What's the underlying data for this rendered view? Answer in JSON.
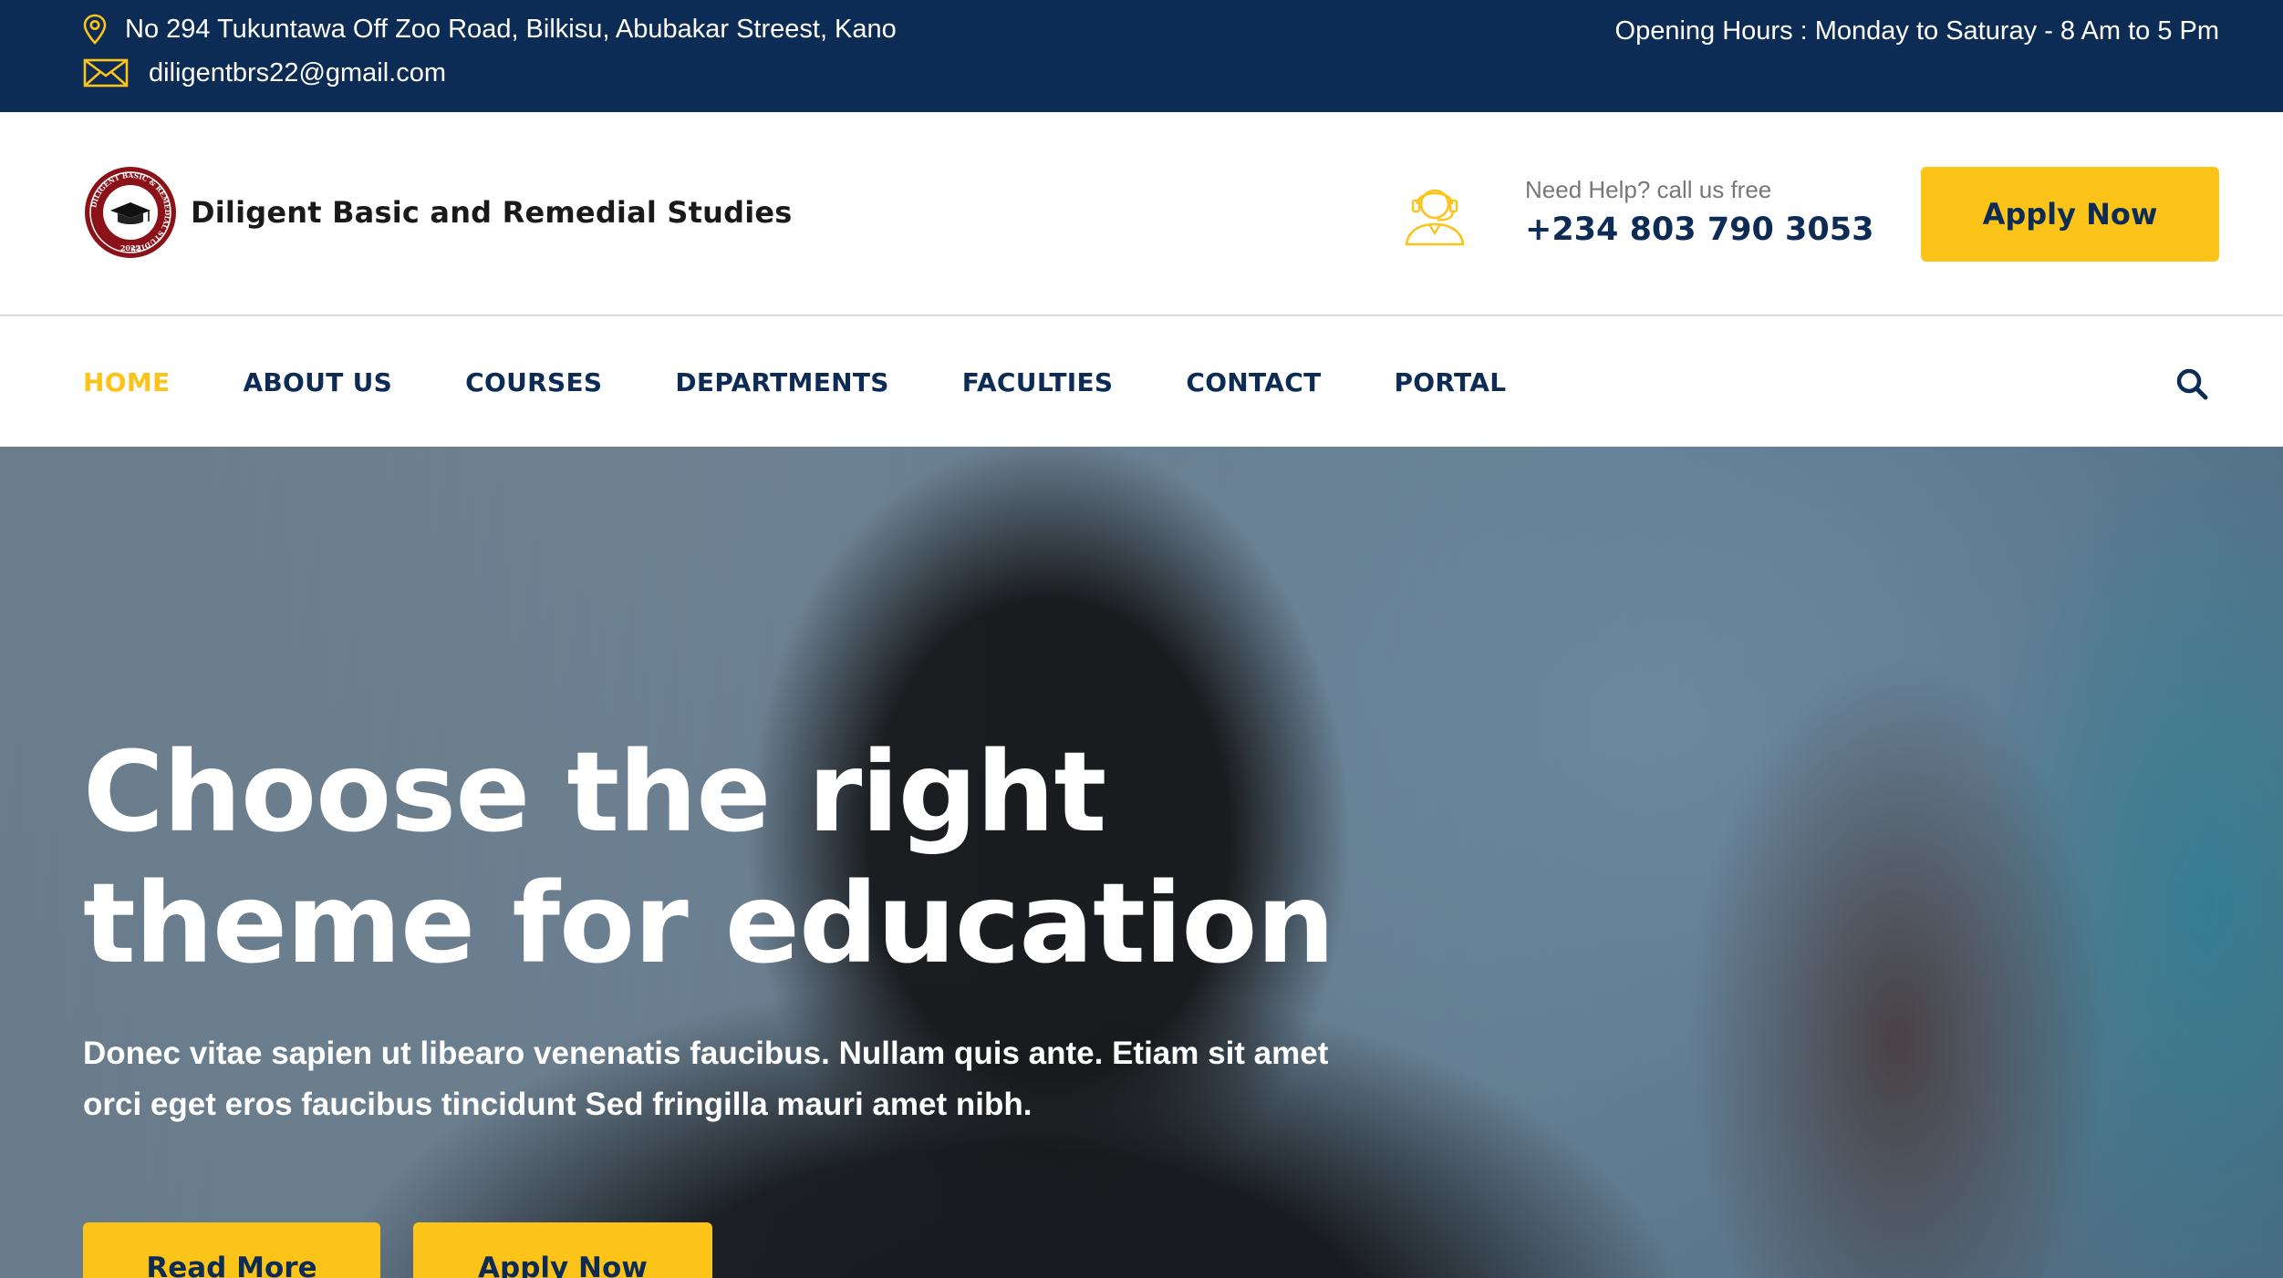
{
  "topbar": {
    "address": "No 294 Tukuntawa Off Zoo Road, Bilkisu, Abubakar Streest, Kano",
    "email": "diligentbrs22@gmail.com",
    "hours": "Opening Hours : Monday to Saturay - 8 Am to 5 Pm",
    "address_icon": "location-pin-icon",
    "email_icon": "envelope-icon"
  },
  "header": {
    "brand_name": "Diligent Basic and Remedial Studies",
    "logo_text": "DILIGENT BASIC & REMEDIAL STUDIES",
    "logo_year": "2022",
    "help_label": "Need Help? call us free",
    "help_phone": "+234 803 790 3053",
    "help_icon": "headset-support-icon",
    "apply_label": "Apply Now"
  },
  "nav": {
    "items": [
      {
        "label": "HOME",
        "active": true
      },
      {
        "label": "ABOUT US",
        "active": false
      },
      {
        "label": "COURSES",
        "active": false
      },
      {
        "label": "DEPARTMENTS",
        "active": false
      },
      {
        "label": "FACULTIES",
        "active": false
      },
      {
        "label": "CONTACT",
        "active": false
      },
      {
        "label": "PORTAL",
        "active": false
      }
    ],
    "search_icon": "search-icon"
  },
  "hero": {
    "title_line1": "Choose the right",
    "title_line2": "theme for education",
    "subtitle": "Donec vitae sapien ut libearo venenatis faucibus. Nullam quis ante. Etiam sit amet orci eget eros faucibus tincidunt Sed fringilla mauri amet nibh.",
    "read_more_label": "Read More",
    "apply_label": "Apply Now"
  },
  "colors": {
    "navy": "#0c2c55",
    "accent_yellow": "#fcc318",
    "text_dark": "#1a1a1a",
    "muted_gray": "#777777"
  }
}
